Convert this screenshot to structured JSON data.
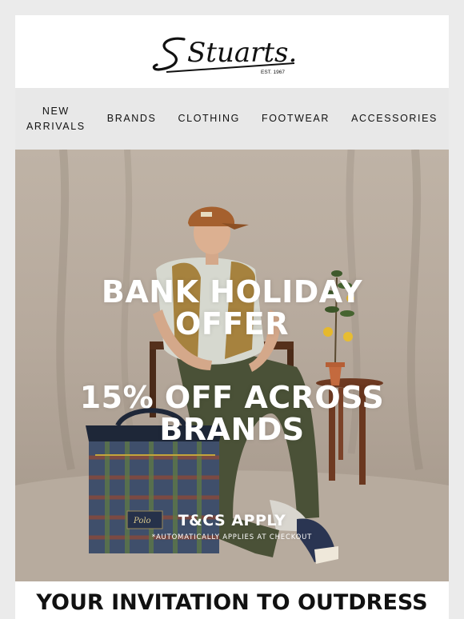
{
  "logo": {
    "brand": "Stuarts.",
    "tagline": "EST. 1967",
    "icon": "stuarts-script-logo"
  },
  "nav": {
    "items": [
      {
        "line1": "NEW",
        "line2": "ARRIVALS"
      },
      {
        "line1": "BRANDS",
        "line2": ""
      },
      {
        "line1": "CLOTHING",
        "line2": ""
      },
      {
        "line1": "FOOTWEAR",
        "line2": ""
      },
      {
        "line1": "ACCESSORIES",
        "line2": ""
      }
    ]
  },
  "hero": {
    "headline_line1": "BANK HOLIDAY",
    "headline_line2": "OFFER",
    "offer_line1": "15% OFF ACROSS",
    "offer_line2": "BRANDS",
    "terms": "T&CS APPLY",
    "note": "*AUTOMATICALLY APPLIES AT CHECKOUT",
    "bag_label": "Polo"
  },
  "footer": {
    "title": "YOUR INVITATION TO OUTDRESS"
  },
  "colors": {
    "page_bg": "#ebebeb",
    "nav_bg": "#e8e8e8",
    "hero_text": "#ffffff"
  }
}
